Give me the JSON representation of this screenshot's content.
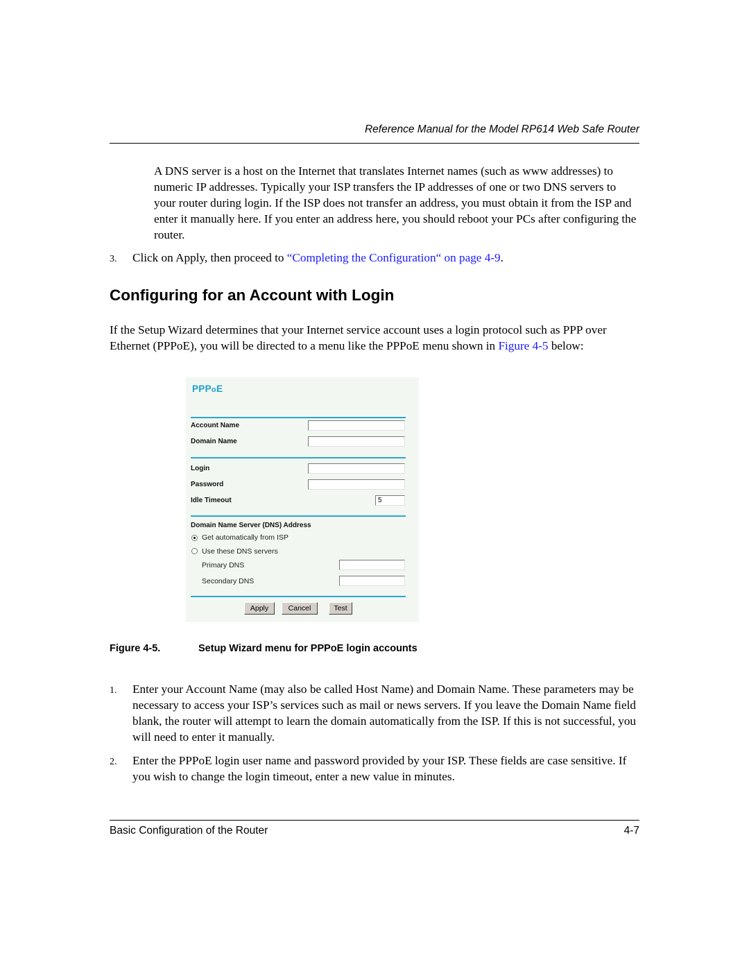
{
  "header": {
    "running_title": "Reference Manual for the Model RP614 Web Safe Router"
  },
  "dns_paragraph": "A DNS server is a host on the Internet that translates Internet names (such as www addresses) to numeric IP addresses. Typically your ISP transfers the IP addresses of one or two DNS servers to your router during login. If the ISP does not transfer an address, you must obtain it from the ISP and enter it manually here. If you enter an address here, you should reboot your PCs after configuring the router.",
  "step3": {
    "number": "3.",
    "text_before": "Click on Apply, then proceed to ",
    "link_text": "“Completing the Configuration“ on page 4-9",
    "text_after": "."
  },
  "section": {
    "title": "Configuring for an Account with Login",
    "intro_before": "If the Setup Wizard determines that your Internet service account uses a login protocol such as PPP over Ethernet (PPPoE), you will be directed to a menu like the PPPoE menu shown in ",
    "intro_link": "Figure 4-5",
    "intro_after": " below:"
  },
  "figure": {
    "panel_title_main": "PPP",
    "panel_title_small": "o",
    "panel_title_end": "E",
    "fields": {
      "account_name": {
        "label": "Account Name",
        "value": ""
      },
      "domain_name": {
        "label": "Domain Name",
        "value": ""
      },
      "login": {
        "label": "Login",
        "value": ""
      },
      "password": {
        "label": "Password",
        "value": ""
      },
      "idle_timeout": {
        "label": "Idle Timeout",
        "value": "5"
      }
    },
    "dns_section_label": "Domain Name Server (DNS) Address",
    "dns_options": [
      {
        "label": "Get automatically from ISP",
        "checked": true
      },
      {
        "label": "Use these DNS servers",
        "checked": false
      }
    ],
    "primary_dns": {
      "label": "Primary DNS",
      "value": ""
    },
    "secondary_dns": {
      "label": "Secondary DNS",
      "value": ""
    },
    "buttons": {
      "apply": "Apply",
      "cancel": "Cancel",
      "test": "Test"
    },
    "accent_color": "#2aa7cf"
  },
  "caption": {
    "label": "Figure 4-5.",
    "text": "Setup Wizard menu for PPPoE login accounts"
  },
  "steps": [
    {
      "number": "1.",
      "text": "Enter your Account Name (may also be called Host Name) and Domain Name. These parameters may be necessary to access your ISP’s services such as mail or news servers. If you leave the Domain Name field blank, the router will attempt to learn the domain automatically from the ISP. If this is not successful, you will need to enter it manually."
    },
    {
      "number": "2.",
      "text": "Enter the PPPoE login user name and password provided by your ISP. These fields are case sensitive. If you wish to change the login timeout, enter a new value in minutes."
    }
  ],
  "footer": {
    "chapter": "Basic Configuration of the Router",
    "page": "4-7"
  }
}
